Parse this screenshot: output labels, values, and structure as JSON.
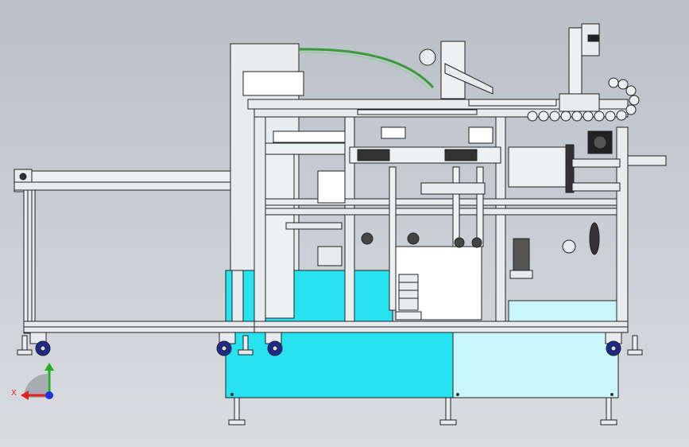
{
  "viewport": {
    "background_top": "#b9c0c8",
    "background_bottom": "#dadde0"
  },
  "model": {
    "description_icon": "machine-assembly-drawing",
    "colors": {
      "frame": "#e8ecef",
      "frame_outline": "#222222",
      "cyan_panel": "#27e3ef",
      "light_cyan_panel": "#c8f6fa",
      "base_panel": "#c7eef3",
      "caster_wheel": "#1b2a8c",
      "green_hose": "#3a9a3a",
      "motor_dark": "#222222",
      "conveyor": "#eef1f3"
    }
  },
  "triad": {
    "x_label": "X",
    "x_color": "#e02020",
    "y_color": "#20b020",
    "z_color": "#2030e0"
  }
}
